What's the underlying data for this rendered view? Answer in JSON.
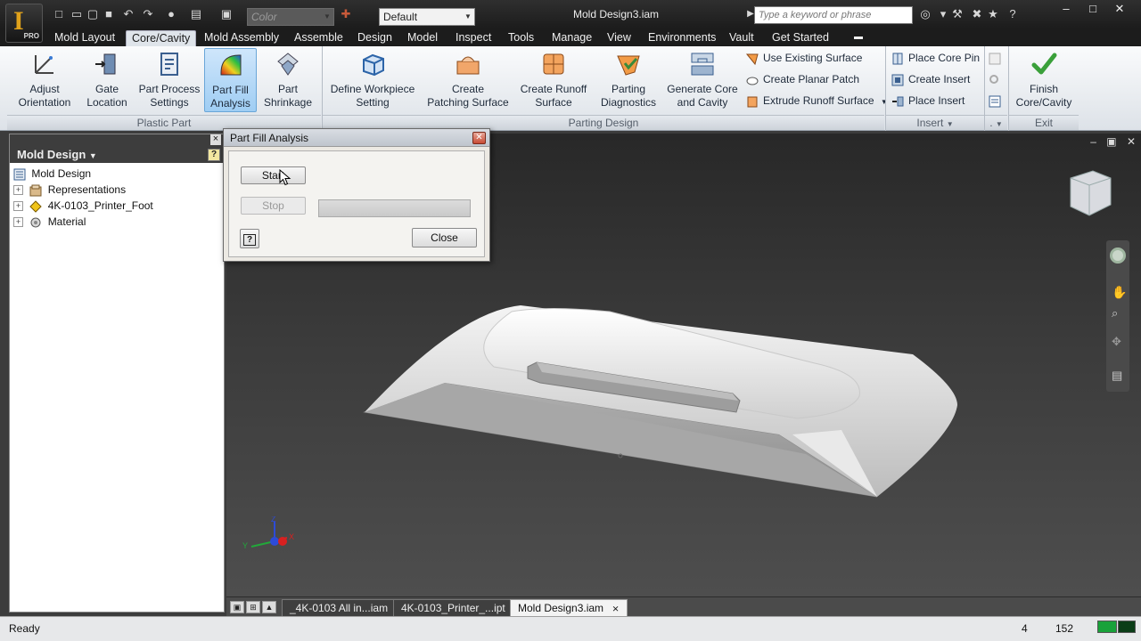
{
  "title_bar": {
    "document_title": "Mold Design3.iam",
    "search_placeholder": "Type a keyword or phrase",
    "logo_text": "PRO",
    "color_combo": "Color",
    "view_rep_combo": "Default"
  },
  "menu": {
    "tabs": [
      {
        "label": "Mold Layout"
      },
      {
        "label": "Core/Cavity",
        "active": true
      },
      {
        "label": "Mold Assembly"
      },
      {
        "label": "Assemble"
      },
      {
        "label": "Design"
      },
      {
        "label": "Model"
      },
      {
        "label": "Inspect"
      },
      {
        "label": "Tools"
      },
      {
        "label": "Manage"
      },
      {
        "label": "View"
      },
      {
        "label": "Environments"
      },
      {
        "label": "Vault"
      },
      {
        "label": "Get Started"
      }
    ]
  },
  "ribbon": {
    "plastic_part": {
      "label": "Plastic Part",
      "buttons": [
        {
          "line1": "Adjust",
          "line2": "Orientation"
        },
        {
          "line1": "Gate",
          "line2": "Location"
        },
        {
          "line1": "Part Process",
          "line2": "Settings"
        },
        {
          "line1": "Part Fill",
          "line2": "Analysis"
        },
        {
          "line1": "Part",
          "line2": "Shrinkage"
        }
      ]
    },
    "parting_design": {
      "label": "Parting Design",
      "buttons": [
        {
          "line1": "Define Workpiece",
          "line2": "Setting"
        },
        {
          "line1": "Create",
          "line2": "Patching Surface"
        },
        {
          "line1": "Create Runoff",
          "line2": "Surface"
        },
        {
          "line1": "Parting",
          "line2": "Diagnostics"
        },
        {
          "line1": "Generate Core",
          "line2": "and Cavity"
        }
      ],
      "small_buttons": [
        {
          "label": "Use Existing Surface"
        },
        {
          "label": "Create Planar Patch"
        },
        {
          "label": "Extrude Runoff Surface"
        }
      ]
    },
    "insert": {
      "label": "Insert",
      "small_buttons": [
        {
          "label": "Place Core Pin"
        },
        {
          "label": "Create Insert"
        },
        {
          "label": "Place Insert"
        }
      ]
    },
    "misc": {
      "label": "."
    },
    "exit": {
      "label": "Exit",
      "finish": {
        "line1": "Finish",
        "line2": "Core/Cavity"
      }
    }
  },
  "browser": {
    "title": "Mold Design",
    "nodes": [
      {
        "label": "Mold Design",
        "level": 0
      },
      {
        "label": "Representations",
        "level": 1
      },
      {
        "label": "4K-0103_Printer_Foot",
        "level": 1
      },
      {
        "label": "Material",
        "level": 1
      }
    ]
  },
  "dialog": {
    "title": "Part Fill Analysis",
    "start_label": "Start",
    "stop_label": "Stop",
    "close_label": "Close",
    "help_label": "?",
    "progress_fraction": 0
  },
  "viewport": {
    "triad": {
      "x": "X",
      "y": "Y",
      "z": "Z"
    }
  },
  "doc_tabs": [
    {
      "label": "_4K-0103 All in...iam"
    },
    {
      "label": "4K-0103_Printer_...ipt"
    },
    {
      "label": "Mold Design3.iam",
      "active": true
    }
  ],
  "status": {
    "text": "Ready",
    "count1": "4",
    "count2": "152"
  },
  "colors": {
    "ribbon_accent": "#9fcdf3",
    "viewport_bg": "#3b3b3b",
    "finish_check": "#3aa03a",
    "status_green": "#19a23a"
  }
}
